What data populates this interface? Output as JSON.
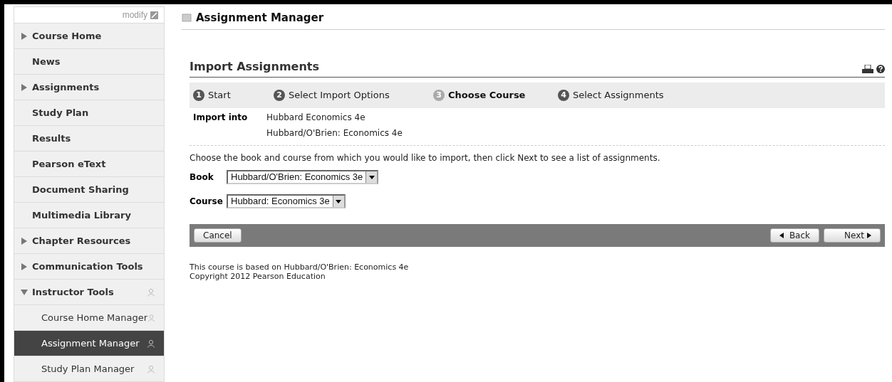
{
  "sidebar": {
    "modify_link": "modify",
    "items": [
      {
        "label": "Course Home",
        "expanded": false
      },
      {
        "label": "News"
      },
      {
        "label": "Assignments",
        "expanded": false
      },
      {
        "label": "Study Plan"
      },
      {
        "label": "Results"
      },
      {
        "label": "Pearson eText"
      },
      {
        "label": "Document Sharing"
      },
      {
        "label": "Multimedia Library"
      },
      {
        "label": "Chapter Resources",
        "expanded": false
      },
      {
        "label": "Communication Tools",
        "expanded": false
      },
      {
        "label": "Instructor Tools",
        "expanded": true,
        "instructor_only": true,
        "children": [
          {
            "label": "Course Home Manager",
            "selected": false
          },
          {
            "label": "Assignment Manager",
            "selected": true
          },
          {
            "label": "Study Plan Manager",
            "selected": false
          }
        ]
      }
    ]
  },
  "page_title": "Assignment Manager",
  "section_title": "Import Assignments",
  "steps": [
    {
      "number": "1",
      "label": "Start",
      "selected": false
    },
    {
      "number": "2",
      "label": "Select Import Options",
      "selected": false
    },
    {
      "number": "3",
      "label": "Choose Course",
      "selected": true
    },
    {
      "number": "4",
      "label": "Select Assignments",
      "selected": false
    }
  ],
  "import_into": {
    "label": "Import into",
    "values": [
      "Hubbard Economics 4e",
      "Hubbard/O'Brien: Economics 4e"
    ]
  },
  "instructions": "Choose the book and course from which you would like to import, then click Next to see a list of assignments.",
  "fields": [
    {
      "label": "Book",
      "value": "Hubbard/O'Brien: Economics 3e"
    },
    {
      "label": "Course",
      "value": "Hubbard: Economics 3e"
    }
  ],
  "buttons": {
    "cancel": "Cancel",
    "back": "Back",
    "next": "Next"
  },
  "footer": [
    "This course is based on Hubbard/O'Brien: Economics 4e",
    "Copyright 2012 Pearson Education"
  ]
}
